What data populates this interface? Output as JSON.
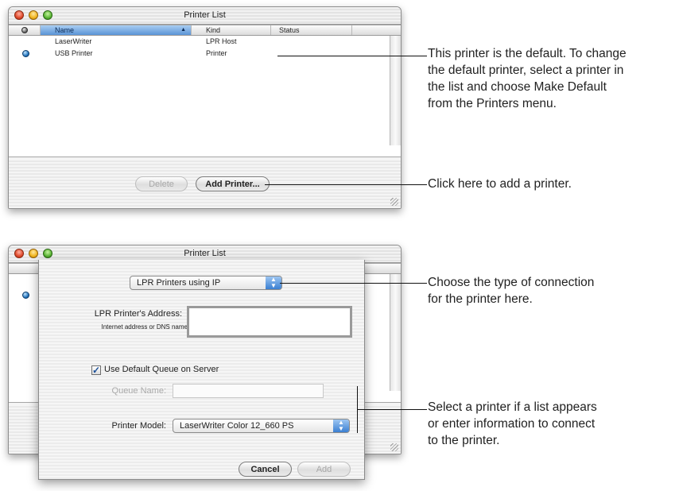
{
  "window1": {
    "title": "Printer List",
    "columns": [
      "",
      "Name",
      "Kind",
      "Status"
    ],
    "sort_indicator": "▲",
    "rows": [
      {
        "default": false,
        "name": "LaserWriter",
        "kind": "LPR Host",
        "status": ""
      },
      {
        "default": true,
        "name": "USB Printer",
        "kind": "Printer",
        "status": ""
      }
    ],
    "buttons": {
      "delete": "Delete",
      "add_printer": "Add Printer..."
    }
  },
  "window2": {
    "title": "Printer List",
    "connection_type": "LPR Printers using IP",
    "address_label": "LPR Printer's Address:",
    "address_hint": "Internet address or DNS name",
    "address_value": "",
    "use_default_queue": {
      "label": "Use Default Queue on Server",
      "checked": true
    },
    "queue_name_label": "Queue Name:",
    "queue_name_value": "",
    "printer_model_label": "Printer Model:",
    "printer_model_value": "LaserWriter Color 12_660 PS",
    "buttons": {
      "cancel": "Cancel",
      "add": "Add"
    }
  },
  "callouts": {
    "default_printer_l1": "This printer is the default. To change",
    "default_printer_l2": "the default printer, select a printer in",
    "default_printer_l3": "the list and choose Make Default",
    "default_printer_l4": "from the Printers menu.",
    "add_printer": "Click here to add a printer.",
    "connection_type_l1": "Choose the type of connection",
    "connection_type_l2": "for the printer here.",
    "select_printer_l1": "Select a printer if a list appears",
    "select_printer_l2": "or enter information to connect",
    "select_printer_l3": "to the printer."
  }
}
